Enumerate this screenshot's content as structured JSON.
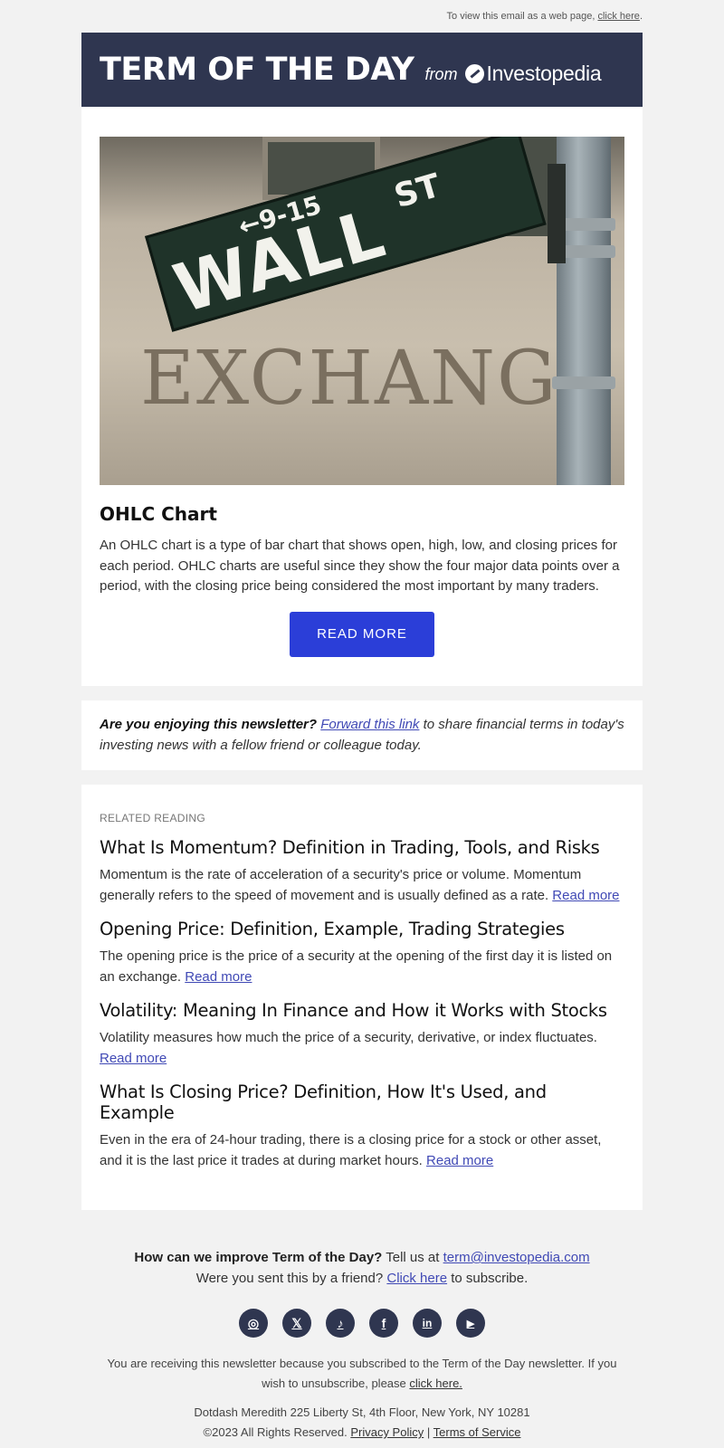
{
  "preheader": {
    "text": "To view this email as a web page, ",
    "link": "click here",
    "end": "."
  },
  "header": {
    "title": "TERM OF THE DAY",
    "from": "from",
    "brand": "Investopedia"
  },
  "hero": {
    "sign_text": "WALL",
    "sign_st": "ST",
    "sign_numbers": "←9-15",
    "building_text": "EXCHANG"
  },
  "term": {
    "title": "OHLC Chart",
    "description": "An OHLC chart is a type of bar chart that shows open, high, low, and closing prices for each period. OHLC charts are useful since they show the four major data points over a period, with the closing price being considered the most important by many traders.",
    "button_label": "READ MORE"
  },
  "share": {
    "lead": "Are you enjoying this newsletter?",
    "link": "Forward this link",
    "rest": "to share financial terms in today's investing news with a fellow friend or colleague today."
  },
  "related": {
    "label": "RELATED READING",
    "read_more": "Read more",
    "articles": [
      {
        "title": "What Is Momentum? Definition in Trading, Tools, and Risks",
        "summary": "Momentum is the rate of acceleration of a security's price or volume. Momentum generally refers to the speed of movement and is usually defined as a rate."
      },
      {
        "title": "Opening Price: Definition, Example, Trading Strategies",
        "summary": "The opening price is the price of a security at the opening of the first day it is listed on an exchange."
      },
      {
        "title": "Volatility: Meaning In Finance and How it Works with Stocks",
        "summary": "Volatility measures how much the price of a security, derivative, or index fluctuates."
      },
      {
        "title": "What Is Closing Price? Definition, How It's Used, and Example",
        "summary": "Even in the era of 24-hour trading, there is a closing price for a stock or other asset, and it is the last price it trades at during market hours."
      }
    ]
  },
  "footer": {
    "improve_question": "How can we improve Term of the Day?",
    "improve_tell": "Tell us at",
    "email": "term@investopedia.com",
    "friend_text": "Were you sent this by a friend?",
    "friend_link": "Click here",
    "friend_end": "to subscribe.",
    "social": [
      {
        "icon": "instagram-icon",
        "glyph": "◎"
      },
      {
        "icon": "x-icon",
        "glyph": "𝕏"
      },
      {
        "icon": "tiktok-icon",
        "glyph": "♪"
      },
      {
        "icon": "facebook-icon",
        "glyph": "f"
      },
      {
        "icon": "linkedin-icon",
        "glyph": "in"
      },
      {
        "icon": "youtube-icon",
        "glyph": "▶"
      }
    ],
    "legal_text": "You are receiving this newsletter because you subscribed to the Term of the Day newsletter. If you wish to unsubscribe, please",
    "unsubscribe_link": "click here.",
    "address": "Dotdash Meredith 225 Liberty St, 4th Floor, New York, NY 10281",
    "copyright": "©2023 All Rights Reserved.",
    "privacy": "Privacy Policy",
    "separator": "|",
    "terms": "Terms of Service"
  },
  "colors": {
    "header_bg": "#2f3650",
    "button_bg": "#2b3ed8",
    "link": "#4049b5",
    "page_bg": "#f2f2f2"
  }
}
